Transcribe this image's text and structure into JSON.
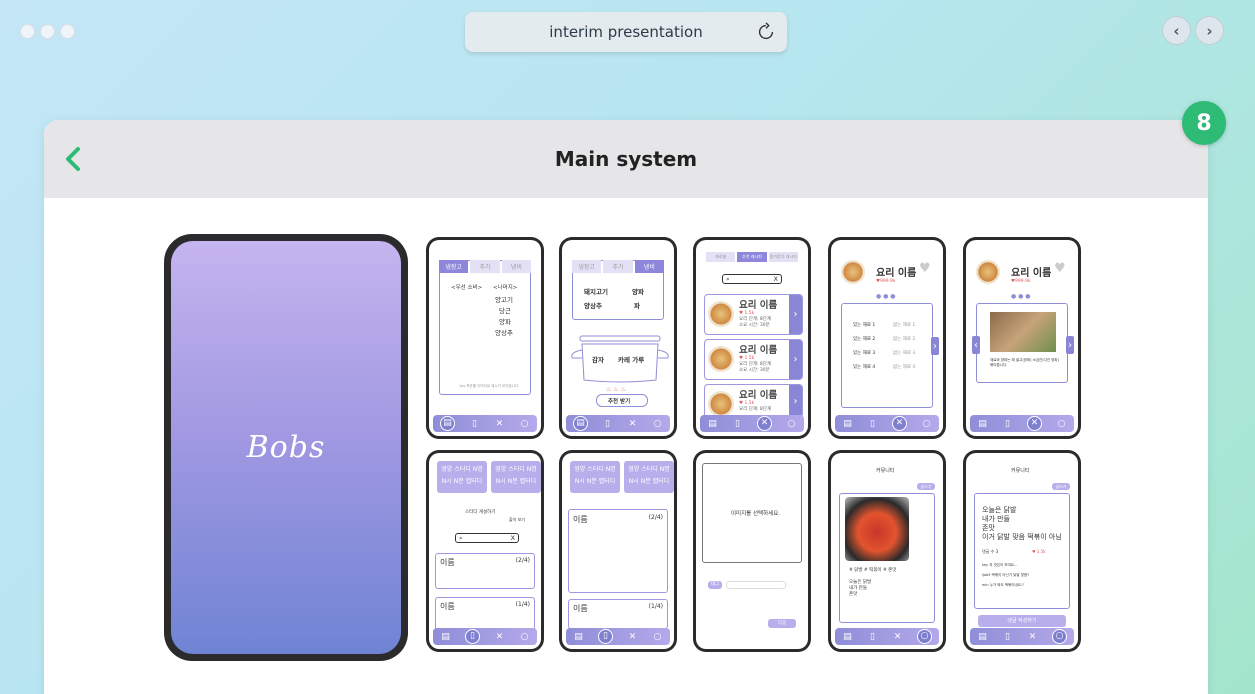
{
  "browser": {
    "address_text": "interim presentation",
    "nav_back_label": "‹",
    "nav_forward_label": "›"
  },
  "badge": {
    "number": "8"
  },
  "card": {
    "title": "Main system",
    "back_label": "‹"
  },
  "splash": {
    "logo_text": "Bobs"
  },
  "screens": {
    "fridge": {
      "tabs": [
        "냉장고",
        "추가",
        "냉비"
      ],
      "col_left": "<우선 소비>",
      "col_right": "<나머지>",
      "items": [
        "양고기",
        "당근",
        "양파",
        "양상추"
      ],
      "footnote": "1ps 목표를 이미지로 제시가 보관됩니다."
    },
    "pot": {
      "tabs": [
        "냉장고",
        "추가",
        "냉비"
      ],
      "ingredients": [
        "돼지고기",
        "양파",
        "양상추",
        "파"
      ],
      "pot_items": [
        "감자",
        "카레 가루"
      ],
      "button": "추천 받기"
    },
    "recipe_list": {
      "tabs": [
        "재료별",
        "추천 레시피",
        "즐겨찾기 레시피"
      ],
      "search_clear": "X",
      "recipe_name": "요리 이름",
      "likes": "♥ 1.5k",
      "meta_1": "요리 단계: 8단계",
      "meta_2": "소요 시간: 30분"
    },
    "recipe_detail_a": {
      "title": "요리 이름",
      "likes": "♥999.9k",
      "rows_left": [
        "있는 재료 1",
        "있는 재료 2",
        "있는 재료 3",
        "있는 재료 4"
      ],
      "rows_right": [
        "없는 재료 1",
        "없는 재료 2",
        "없는 재료 3",
        "없는 재료 4"
      ]
    },
    "recipe_detail_b": {
      "title": "요리 이름",
      "likes": "♥999.9k",
      "step_text": "재료와 양파는 채 썰고(양파) 소금간(다진 양파) 볶아줍니다."
    },
    "study_list": {
      "chip_1": "영양 스터디 N명",
      "chip_1b": "N시 N분 랩터디",
      "chip_2": "영양 스터디 N명",
      "chip_2b": "N시 N분 랩터디",
      "open_study": "스터디 개설하기",
      "checkbox": "출석 보기",
      "search_clear": "X",
      "card1_name": "이름",
      "card1_count": "(2/4)",
      "card2_name": "이름",
      "card2_count": "(1/4)"
    },
    "study_detail": {
      "chip_1": "영양 스터디 N명",
      "chip_1b": "N시 N분 랩터디",
      "chip_2": "영양 스터디 N명",
      "chip_2b": "N시 N분 랩터디",
      "card1_name": "이름",
      "card1_count": "(2/4)",
      "card2_name": "이름",
      "card2_count": "(1/4)"
    },
    "image_select": {
      "prompt": "이미지를 선택하세요.",
      "label": "태그",
      "next": "다음"
    },
    "community_a": {
      "title": "커뮤니티",
      "write": "글쓰기",
      "tags": "# 닭발 # 떡볶이 # 존맛",
      "lines": [
        "오늘은 닭발",
        "내가 만들",
        "존맛"
      ]
    },
    "community_b": {
      "title": "커뮤니티",
      "write": "글쓰기",
      "post_lines": [
        "오늘은 닭발",
        "내가 만들",
        "존맛",
        "이거 닭발 맞음 떡볶이 아님"
      ],
      "comment_count": "댓글 수 3",
      "likes": "♥ 1.5k",
      "comments": [
        "key 저 맛있어 보여요...",
        "ljab5 떡볶이 아닌가 닭발 맞음?",
        "min 누가 봐도 떡볶이네요.?"
      ],
      "button": "댓글 작성하기"
    }
  }
}
